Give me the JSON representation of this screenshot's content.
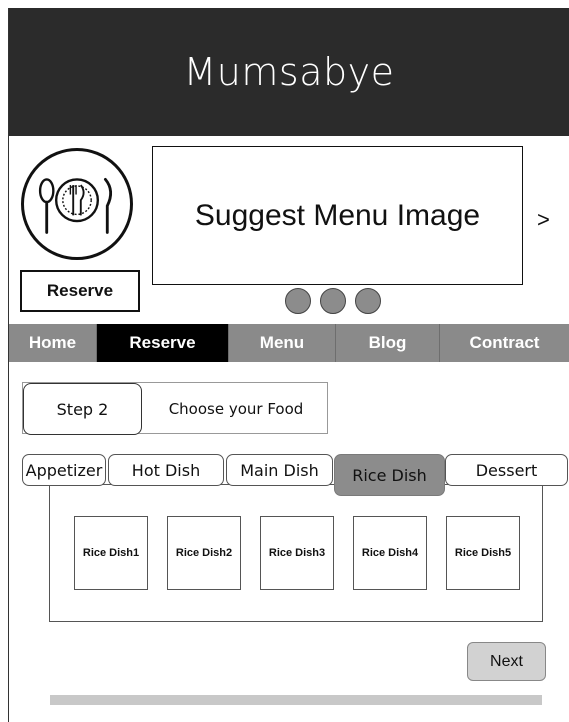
{
  "header": {
    "title": "Mumsabye"
  },
  "logo": {
    "icon": "plate-cutlery-icon"
  },
  "reserve_button": {
    "label": "Reserve"
  },
  "banner": {
    "text": "Suggest Menu Image",
    "next_arrow": ">"
  },
  "carousel": {
    "dot_count": 3
  },
  "nav": {
    "items": [
      {
        "label": "Home",
        "active": false
      },
      {
        "label": "Reserve",
        "active": true
      },
      {
        "label": "Menu",
        "active": false
      },
      {
        "label": "Blog",
        "active": false
      },
      {
        "label": "Contract",
        "active": false
      }
    ]
  },
  "step": {
    "number": "Step 2",
    "text": "Choose your Food"
  },
  "tabs": [
    {
      "label": "Appetizer",
      "active": false
    },
    {
      "label": "Hot Dish",
      "active": false
    },
    {
      "label": "Main Dish",
      "active": false
    },
    {
      "label": "Rice Dish",
      "active": true
    },
    {
      "label": "Dessert",
      "active": false
    }
  ],
  "dishes": [
    "Rice Dish1",
    "Rice Dish2",
    "Rice Dish3",
    "Rice Dish4",
    "Rice Dish5"
  ],
  "next_button": {
    "label": "Next"
  },
  "colors": {
    "header_bg": "#2b2b2b",
    "nav_bg": "#8a8a8a",
    "nav_active_bg": "#000000",
    "tab_active_bg": "#8c8c8c"
  }
}
